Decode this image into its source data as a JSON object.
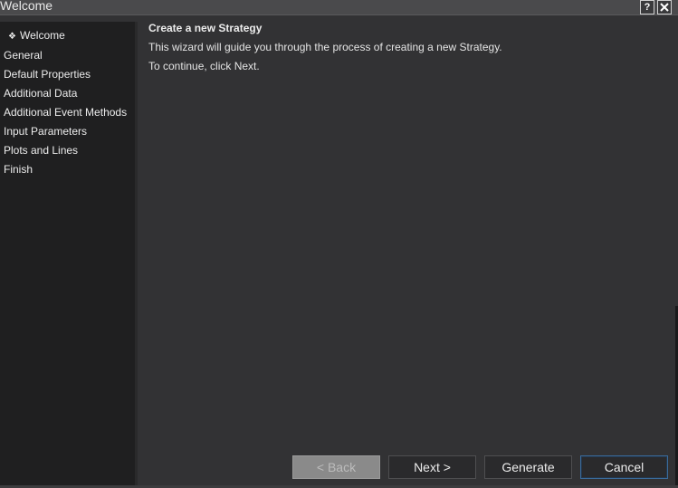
{
  "window": {
    "title": "Welcome",
    "help_label": "?",
    "close_icon": "close-icon"
  },
  "sidebar": {
    "items": [
      {
        "label": "Welcome",
        "active": true,
        "bullet": "❖"
      },
      {
        "label": "General",
        "active": false
      },
      {
        "label": "Default Properties",
        "active": false
      },
      {
        "label": "Additional Data",
        "active": false
      },
      {
        "label": "Additional Event Methods",
        "active": false
      },
      {
        "label": "Input Parameters",
        "active": false
      },
      {
        "label": "Plots and Lines",
        "active": false
      },
      {
        "label": "Finish",
        "active": false
      }
    ]
  },
  "content": {
    "title": "Create a new Strategy",
    "lines": [
      "This wizard will guide you through the process of creating a new Strategy.",
      "To continue, click Next."
    ]
  },
  "buttons": {
    "back": "< Back",
    "next": "Next >",
    "generate": "Generate",
    "cancel": "Cancel"
  },
  "colors": {
    "background": "#323234",
    "sidebar": "#1f1f20",
    "titlebar": "#4a4a4c",
    "text": "#ececec",
    "disabled_button": "#8a8a8a"
  }
}
